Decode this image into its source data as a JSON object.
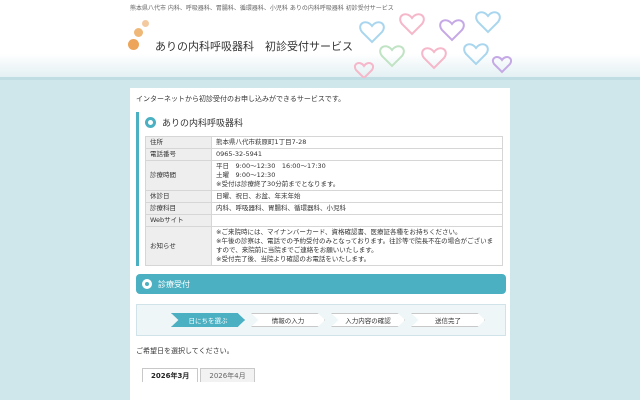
{
  "top_caption": "熊本県八代市 内科、呼吸器科、胃腸科、循環器科、小児科 ありの内科呼吸器科 初診受付サービス",
  "header": {
    "title": "ありの内科呼吸器科　初診受付サービス"
  },
  "intro": "インターネットから初診受付のお申し込みができるサービスです。",
  "clinic": {
    "name": "ありの内科呼吸器科",
    "rows": [
      {
        "label": "住所",
        "value": "熊本県八代市萩原町1丁目7-28"
      },
      {
        "label": "電話番号",
        "value": "0965-32-5941"
      },
      {
        "label": "診療時間",
        "lines": [
          "平日　9:00〜12:30　16:00〜17:30",
          "土曜　9:00〜12:30",
          "※受付は診療終了30分前までとなります。"
        ]
      },
      {
        "label": "休診日",
        "value": "日曜、祝日、お盆、年末年始"
      },
      {
        "label": "診療科目",
        "value": "内科、呼吸器科、胃腸科、循環器科、小児科"
      },
      {
        "label": "Webサイト",
        "value": ""
      },
      {
        "label": "お知らせ",
        "lines": [
          "※ご来院時には、マイナンバーカード、資格確認書、医療証各種をお持ちください。",
          "※午後の診察は、電話での予約受付のみとなっております。往診等で院長不在の場合がございますので、来院前に当院までご連絡をお願いいたします。",
          "※受付完了後、当院より確認のお電話をいたします。"
        ]
      }
    ]
  },
  "section": {
    "title": "診療受付"
  },
  "steps": [
    "日にちを選ぶ",
    "情報の入力",
    "入力内容の確認",
    "送信完了"
  ],
  "choose_text": "ご希望日を選択してください。",
  "tabs": [
    "2026年3月",
    "2026年4月"
  ],
  "colors": {
    "accent": "#4bb0c2",
    "background": "#cfe6ea"
  }
}
